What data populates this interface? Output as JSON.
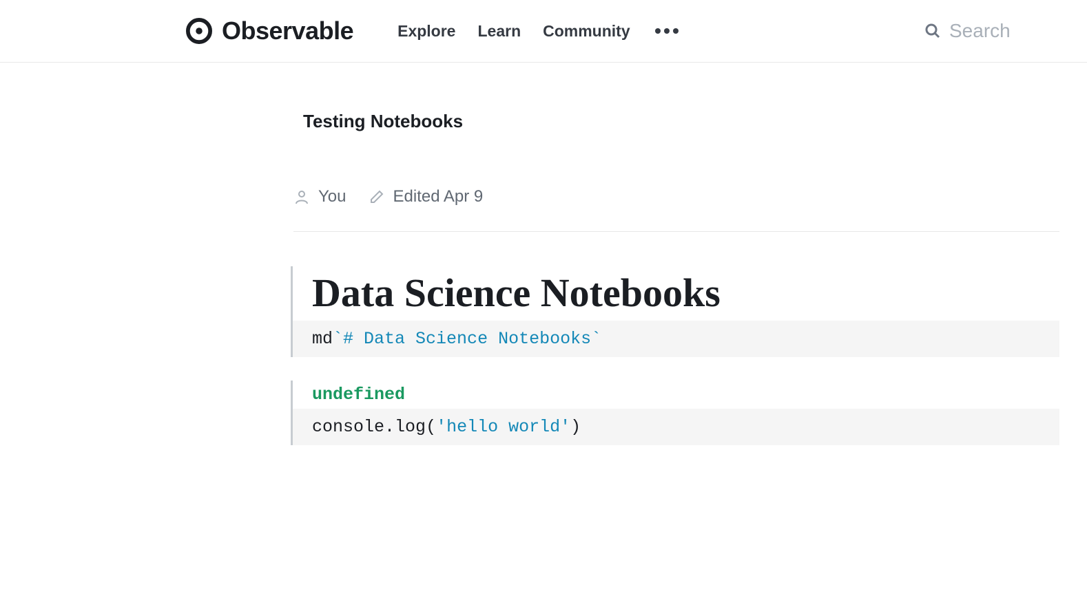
{
  "header": {
    "brand": "Observable",
    "nav": {
      "explore": "Explore",
      "learn": "Learn",
      "community": "Community"
    },
    "search_placeholder": "Search"
  },
  "breadcrumb": "Testing Notebooks",
  "meta": {
    "author": "You",
    "edited": "Edited Apr 9"
  },
  "cells": [
    {
      "heading": "Data Science Notebooks",
      "code": {
        "prefix": "md",
        "backtick_open": "`",
        "body": "# Data Science Notebooks",
        "backtick_close": "`"
      }
    },
    {
      "undefined_output": "undefined",
      "code2": {
        "obj": "console",
        "dot": ".",
        "method": "log",
        "open": "(",
        "str": "'hello world'",
        "close": ")"
      }
    }
  ]
}
